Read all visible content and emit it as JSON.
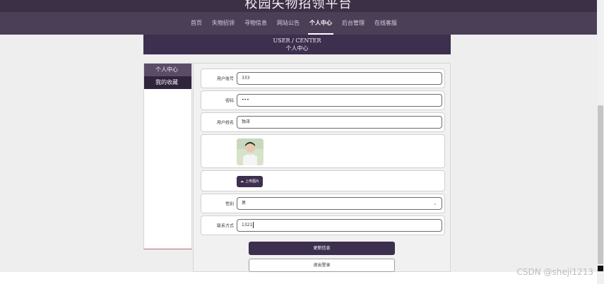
{
  "app": {
    "title": "校园失物招领平台",
    "watermark": "CSDN @sheji1213"
  },
  "nav": {
    "items": [
      {
        "label": "首页"
      },
      {
        "label": "失物招领"
      },
      {
        "label": "寻物信息"
      },
      {
        "label": "网站公告"
      },
      {
        "label": "个人中心",
        "active": true
      },
      {
        "label": "后台管理"
      },
      {
        "label": "在线客服"
      }
    ]
  },
  "banner": {
    "title_en": "USER / CENTER",
    "title_cn": "个人中心"
  },
  "sidebar": {
    "items": [
      {
        "label": "个人中心"
      },
      {
        "label": "我的收藏"
      }
    ]
  },
  "form": {
    "fields": {
      "account": {
        "label": "用户账号",
        "value": "333"
      },
      "password": {
        "label": "密码",
        "value": "•••"
      },
      "name": {
        "label": "用户姓名",
        "value": "独泽"
      },
      "gender": {
        "label": "性别",
        "value": "男"
      },
      "contact": {
        "label": "联系方式",
        "value": "1321"
      }
    },
    "upload_label": "上传图片",
    "update_button": "更新信息",
    "logout_button": "退出登录"
  },
  "icons": {
    "upload": "cloud-upload-icon",
    "dropdown": "chevron-down-icon"
  },
  "colors": {
    "nav_bg": "#4b3f57",
    "accent": "#3d2f4e",
    "panel_bg": "#f1f1f1"
  }
}
